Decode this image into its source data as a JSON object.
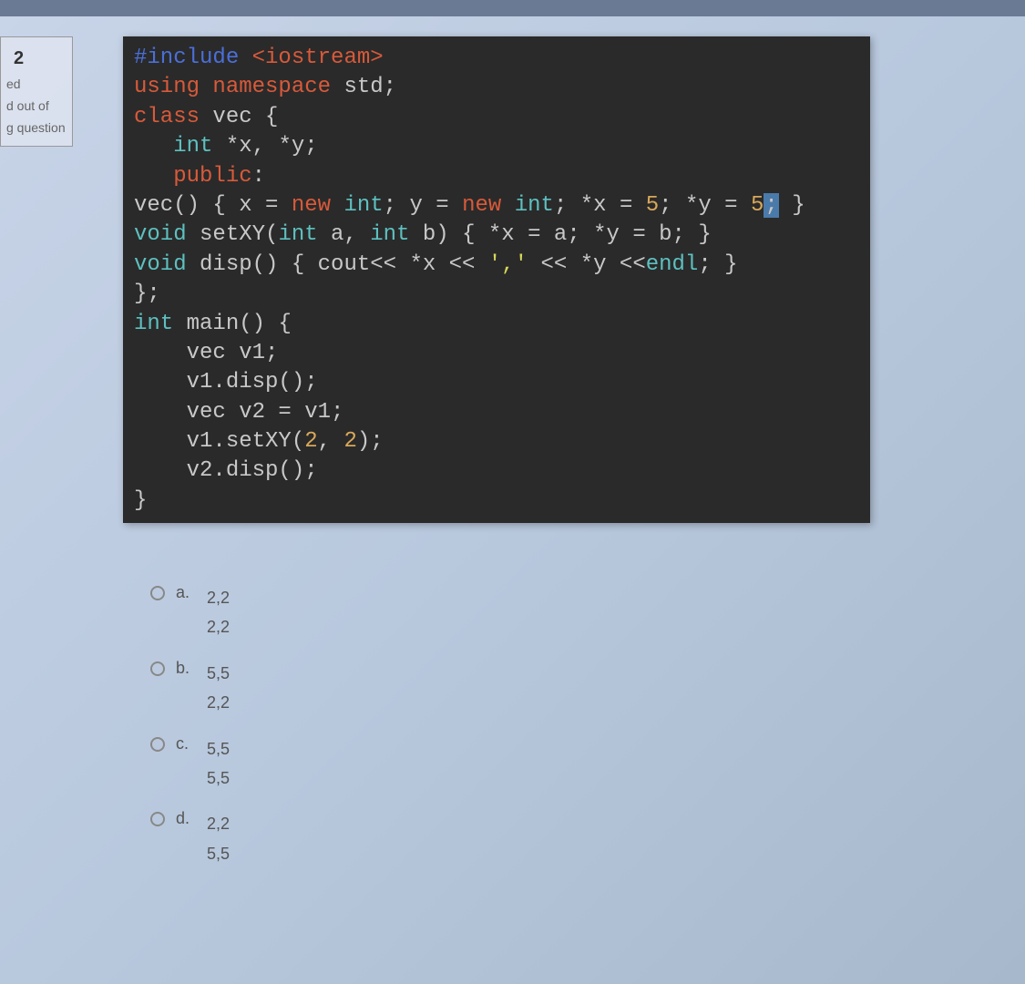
{
  "sidebar": {
    "question_number": "2",
    "status_text": "ed",
    "marks_text": "d out of",
    "flag_text": "g question"
  },
  "code": {
    "lines": [
      {
        "segments": [
          {
            "cls": "tok-preproc",
            "t": "#include"
          },
          {
            "cls": "tok-ident",
            "t": " "
          },
          {
            "cls": "tok-include",
            "t": "<iostream>"
          }
        ]
      },
      {
        "segments": [
          {
            "cls": "tok-keyword",
            "t": "using"
          },
          {
            "cls": "tok-ident",
            "t": " "
          },
          {
            "cls": "tok-keyword",
            "t": "namespace"
          },
          {
            "cls": "tok-ident",
            "t": " std;"
          }
        ]
      },
      {
        "segments": [
          {
            "cls": "tok-keyword",
            "t": "class"
          },
          {
            "cls": "tok-ident",
            "t": " vec {"
          }
        ]
      },
      {
        "segments": [
          {
            "cls": "tok-ident",
            "t": "   "
          },
          {
            "cls": "tok-type",
            "t": "int"
          },
          {
            "cls": "tok-ident",
            "t": " *x, *y;"
          }
        ]
      },
      {
        "segments": [
          {
            "cls": "tok-ident",
            "t": "   "
          },
          {
            "cls": "tok-keyword",
            "t": "public"
          },
          {
            "cls": "tok-ident",
            "t": ":"
          }
        ]
      },
      {
        "segments": [
          {
            "cls": "tok-ident",
            "t": "vec() { x = "
          },
          {
            "cls": "tok-keyword",
            "t": "new"
          },
          {
            "cls": "tok-ident",
            "t": " "
          },
          {
            "cls": "tok-type",
            "t": "int"
          },
          {
            "cls": "tok-ident",
            "t": "; y = "
          },
          {
            "cls": "tok-keyword",
            "t": "new"
          },
          {
            "cls": "tok-ident",
            "t": " "
          },
          {
            "cls": "tok-type",
            "t": "int"
          },
          {
            "cls": "tok-ident",
            "t": "; *x = "
          },
          {
            "cls": "tok-num",
            "t": "5"
          },
          {
            "cls": "tok-ident",
            "t": "; *y = "
          },
          {
            "cls": "tok-num",
            "t": "5"
          },
          {
            "cls": "cursor-highlight",
            "t": ";"
          },
          {
            "cls": "tok-ident",
            "t": " }"
          }
        ]
      },
      {
        "segments": [
          {
            "cls": "tok-type",
            "t": "void"
          },
          {
            "cls": "tok-ident",
            "t": " setXY("
          },
          {
            "cls": "tok-type",
            "t": "int"
          },
          {
            "cls": "tok-ident",
            "t": " a, "
          },
          {
            "cls": "tok-type",
            "t": "int"
          },
          {
            "cls": "tok-ident",
            "t": " b) { *x = a; *y = b; }"
          }
        ]
      },
      {
        "segments": [
          {
            "cls": "tok-type",
            "t": "void"
          },
          {
            "cls": "tok-ident",
            "t": " disp() { cout<< *x << "
          },
          {
            "cls": "tok-string",
            "t": "','"
          },
          {
            "cls": "tok-ident",
            "t": " << *y <<"
          },
          {
            "cls": "tok-endl",
            "t": "endl"
          },
          {
            "cls": "tok-ident",
            "t": "; }"
          }
        ]
      },
      {
        "segments": [
          {
            "cls": "tok-ident",
            "t": "};"
          }
        ]
      },
      {
        "segments": [
          {
            "cls": "tok-type",
            "t": "int"
          },
          {
            "cls": "tok-ident",
            "t": " main() {"
          }
        ]
      },
      {
        "segments": [
          {
            "cls": "tok-ident",
            "t": "    vec v1;"
          }
        ]
      },
      {
        "segments": [
          {
            "cls": "tok-ident",
            "t": "    v1.disp();"
          }
        ]
      },
      {
        "segments": [
          {
            "cls": "tok-ident",
            "t": "    vec v2 = v1;"
          }
        ]
      },
      {
        "segments": [
          {
            "cls": "tok-ident",
            "t": "    v1.setXY("
          },
          {
            "cls": "tok-num",
            "t": "2"
          },
          {
            "cls": "tok-ident",
            "t": ", "
          },
          {
            "cls": "tok-num",
            "t": "2"
          },
          {
            "cls": "tok-ident",
            "t": ");"
          }
        ]
      },
      {
        "segments": [
          {
            "cls": "tok-ident",
            "t": "    v2.disp();"
          }
        ]
      },
      {
        "segments": [
          {
            "cls": "tok-ident",
            "t": "}"
          }
        ]
      }
    ]
  },
  "answers": {
    "options": [
      {
        "label": "a.",
        "text": "2,2\n2,2"
      },
      {
        "label": "b.",
        "text": "5,5\n2,2"
      },
      {
        "label": "c.",
        "text": "5,5\n5,5"
      },
      {
        "label": "d.",
        "text": "2,2\n5,5"
      }
    ]
  }
}
